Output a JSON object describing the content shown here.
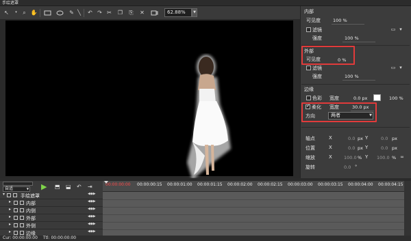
{
  "window": {
    "title": "手绘遮罩"
  },
  "toolbar": {
    "zoom_value": "62.88%",
    "icons": [
      "select-arrow-icon",
      "magnifier-icon",
      "hand-icon",
      "rectangle-icon",
      "ellipse-icon",
      "pen-icon",
      "brush-icon",
      "undo-icon",
      "redo-icon",
      "copy-icon",
      "paste-icon",
      "delete-icon",
      "video-icon"
    ]
  },
  "panel": {
    "inner": {
      "title": "内部",
      "visibility_label": "可见度",
      "visibility_value": "100 %",
      "filter_label": "滤镜",
      "strength_label": "强度",
      "strength_value": "100 %"
    },
    "outer": {
      "title": "外部",
      "visibility_label": "可见度",
      "visibility_value": "0 %",
      "filter_label": "滤镜",
      "strength_label": "强度",
      "strength_value": "100 %"
    },
    "edge": {
      "title": "边缘",
      "color_label": "色彩",
      "width_label": "宽度",
      "width_value": "0.0 px",
      "color_opacity": "100 %",
      "soften_label": "柔化",
      "soften_width_label": "宽度",
      "soften_width_value": "30.0 px",
      "direction_label": "方向",
      "direction_value": "两者"
    },
    "transform": {
      "anchor_label": "轴点",
      "position_label": "位置",
      "scale_label": "缩放",
      "rotate_label": "旋转",
      "x_label": "X",
      "y_label": "Y",
      "anchor_x": "0.0",
      "anchor_y": "0.0",
      "anchor_unit": "px",
      "position_x": "0.0",
      "position_y": "0.0",
      "position_unit": "px",
      "scale_x": "100.0",
      "scale_y": "100.0",
      "scale_unit": "%",
      "rotate_value": "0.0",
      "rotate_unit": "°"
    }
  },
  "timeline": {
    "mode_value": "自适",
    "timecodes": [
      "00:00:00:00",
      "00:00:00:15",
      "00:00:01:00",
      "00:00:01:15",
      "00:00:02:00",
      "00:00:02:15",
      "00:00:03:00",
      "00:00:03:15",
      "00:00:04:00",
      "00:00:04:15"
    ],
    "tracks": [
      {
        "name": "手绘遮罩",
        "level": 0
      },
      {
        "name": "内部",
        "level": 1
      },
      {
        "name": "内侧",
        "level": 1
      },
      {
        "name": "外部",
        "level": 1
      },
      {
        "name": "外侧",
        "level": 1
      },
      {
        "name": "边缘",
        "level": 1
      }
    ]
  },
  "status": {
    "cur_label": "Cur:",
    "cur_value": "00:00:00:00",
    "ttl_label": "Ttl:",
    "ttl_value": "00:00:00:00"
  },
  "colors": {
    "highlight": "#e23b3b",
    "canvas": "#000000",
    "panel": "#3c3c3c"
  }
}
